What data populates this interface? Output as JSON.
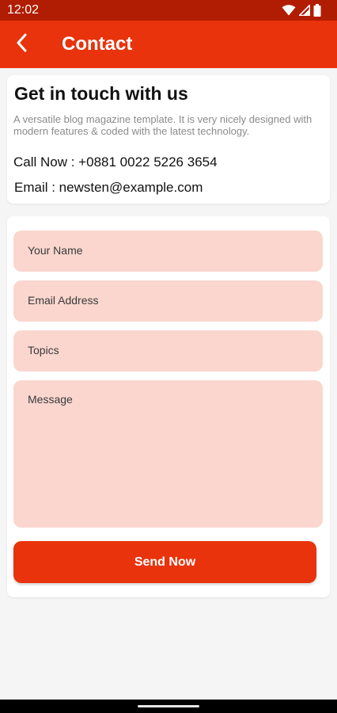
{
  "status_bar": {
    "time": "12:02",
    "icons": [
      "wifi-icon",
      "signal-icon",
      "battery-icon"
    ]
  },
  "app_bar": {
    "back_icon": "chevron-left-icon",
    "title": "Contact"
  },
  "info": {
    "heading": "Get in touch with us",
    "description": "A versatile blog magazine template. It is very nicely designed with modern features & coded with the latest technology.",
    "call_line": "Call Now : +0881 0022 5226 3654",
    "email_line": "Email : newsten@example.com"
  },
  "form": {
    "fields": [
      {
        "label": "Your Name"
      },
      {
        "label": "Email Address"
      },
      {
        "label": "Topics"
      },
      {
        "label": "Message"
      }
    ],
    "submit_label": "Send Now"
  },
  "colors": {
    "status_bar": "#b11d02",
    "primary": "#e8330c",
    "field_background": "#fad6cf",
    "page_background": "#f5f5f5"
  }
}
